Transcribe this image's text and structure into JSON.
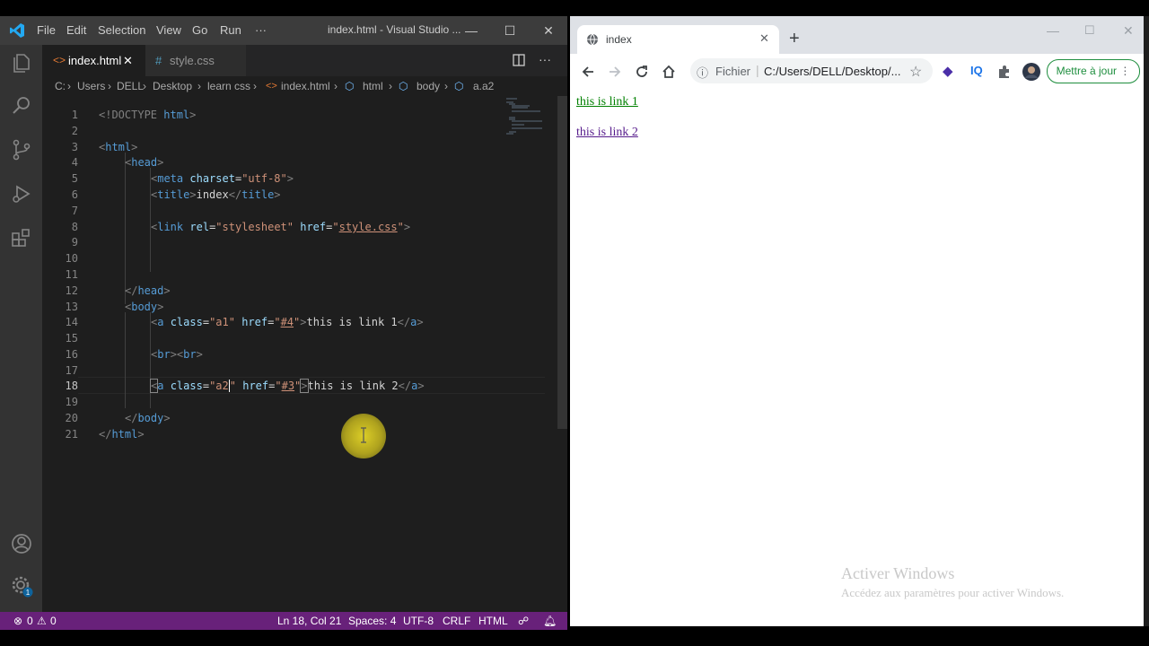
{
  "vscode": {
    "menu": [
      "File",
      "Edit",
      "Selection",
      "View",
      "Go",
      "Run",
      "···"
    ],
    "title": "index.html - Visual Studio ...",
    "tabs": [
      {
        "label": "index.html",
        "icon": "html-file-icon"
      },
      {
        "label": "style.css",
        "icon": "css-file-icon"
      }
    ],
    "breadcrumb": [
      "C:",
      "Users",
      "DELL",
      "Desktop",
      "learn css",
      "index.html",
      "html",
      "body",
      "a.a2"
    ],
    "lines": [
      "1",
      "2",
      "3",
      "4",
      "5",
      "6",
      "7",
      "8",
      "9",
      "10",
      "11",
      "12",
      "13",
      "14",
      "15",
      "16",
      "17",
      "18",
      "19",
      "20",
      "21"
    ],
    "code": {
      "l1a": "<!DOCTYPE",
      "l1b": " html",
      "l1c": ">",
      "html": "html",
      "head": "head",
      "meta": "meta",
      "charset": "charset",
      "utf8": "\"utf-8\"",
      "title": "title",
      "title_text": "index",
      "link": "link",
      "rel": "rel",
      "rel_val": "\"stylesheet\"",
      "href": "href",
      "css_q": "\"",
      "css_val": "style.css",
      "body": "body",
      "a": "a",
      "class": "class",
      "a1": "\"a1\"",
      "h4_val": "#4",
      "link1_text": "this is link 1",
      "br": "br",
      "a2": "a2",
      "h3_val": "#3",
      "link2_text": "this is link 2"
    },
    "status": {
      "errors": "0",
      "warnings": "0",
      "position": "Ln 18, Col 21",
      "spaces": "Spaces: 4",
      "encoding": "UTF-8",
      "eol": "CRLF",
      "language": "HTML"
    }
  },
  "browser": {
    "tab_title": "index",
    "site_info": "Fichier",
    "url": "C:/Users/DELL/Desktop/...",
    "update_button": "Mettre à jour",
    "page": {
      "link1": "this is link 1",
      "link2": "this is link 2"
    },
    "watermark_title": "Activer Windows",
    "watermark_sub": "Accédez aux paramètres pour activer Windows."
  },
  "colors": {
    "statusbar": "#68217a",
    "link_green": "#008000",
    "link_visited": "#551a8b",
    "update_green": "#1e8e3e"
  }
}
